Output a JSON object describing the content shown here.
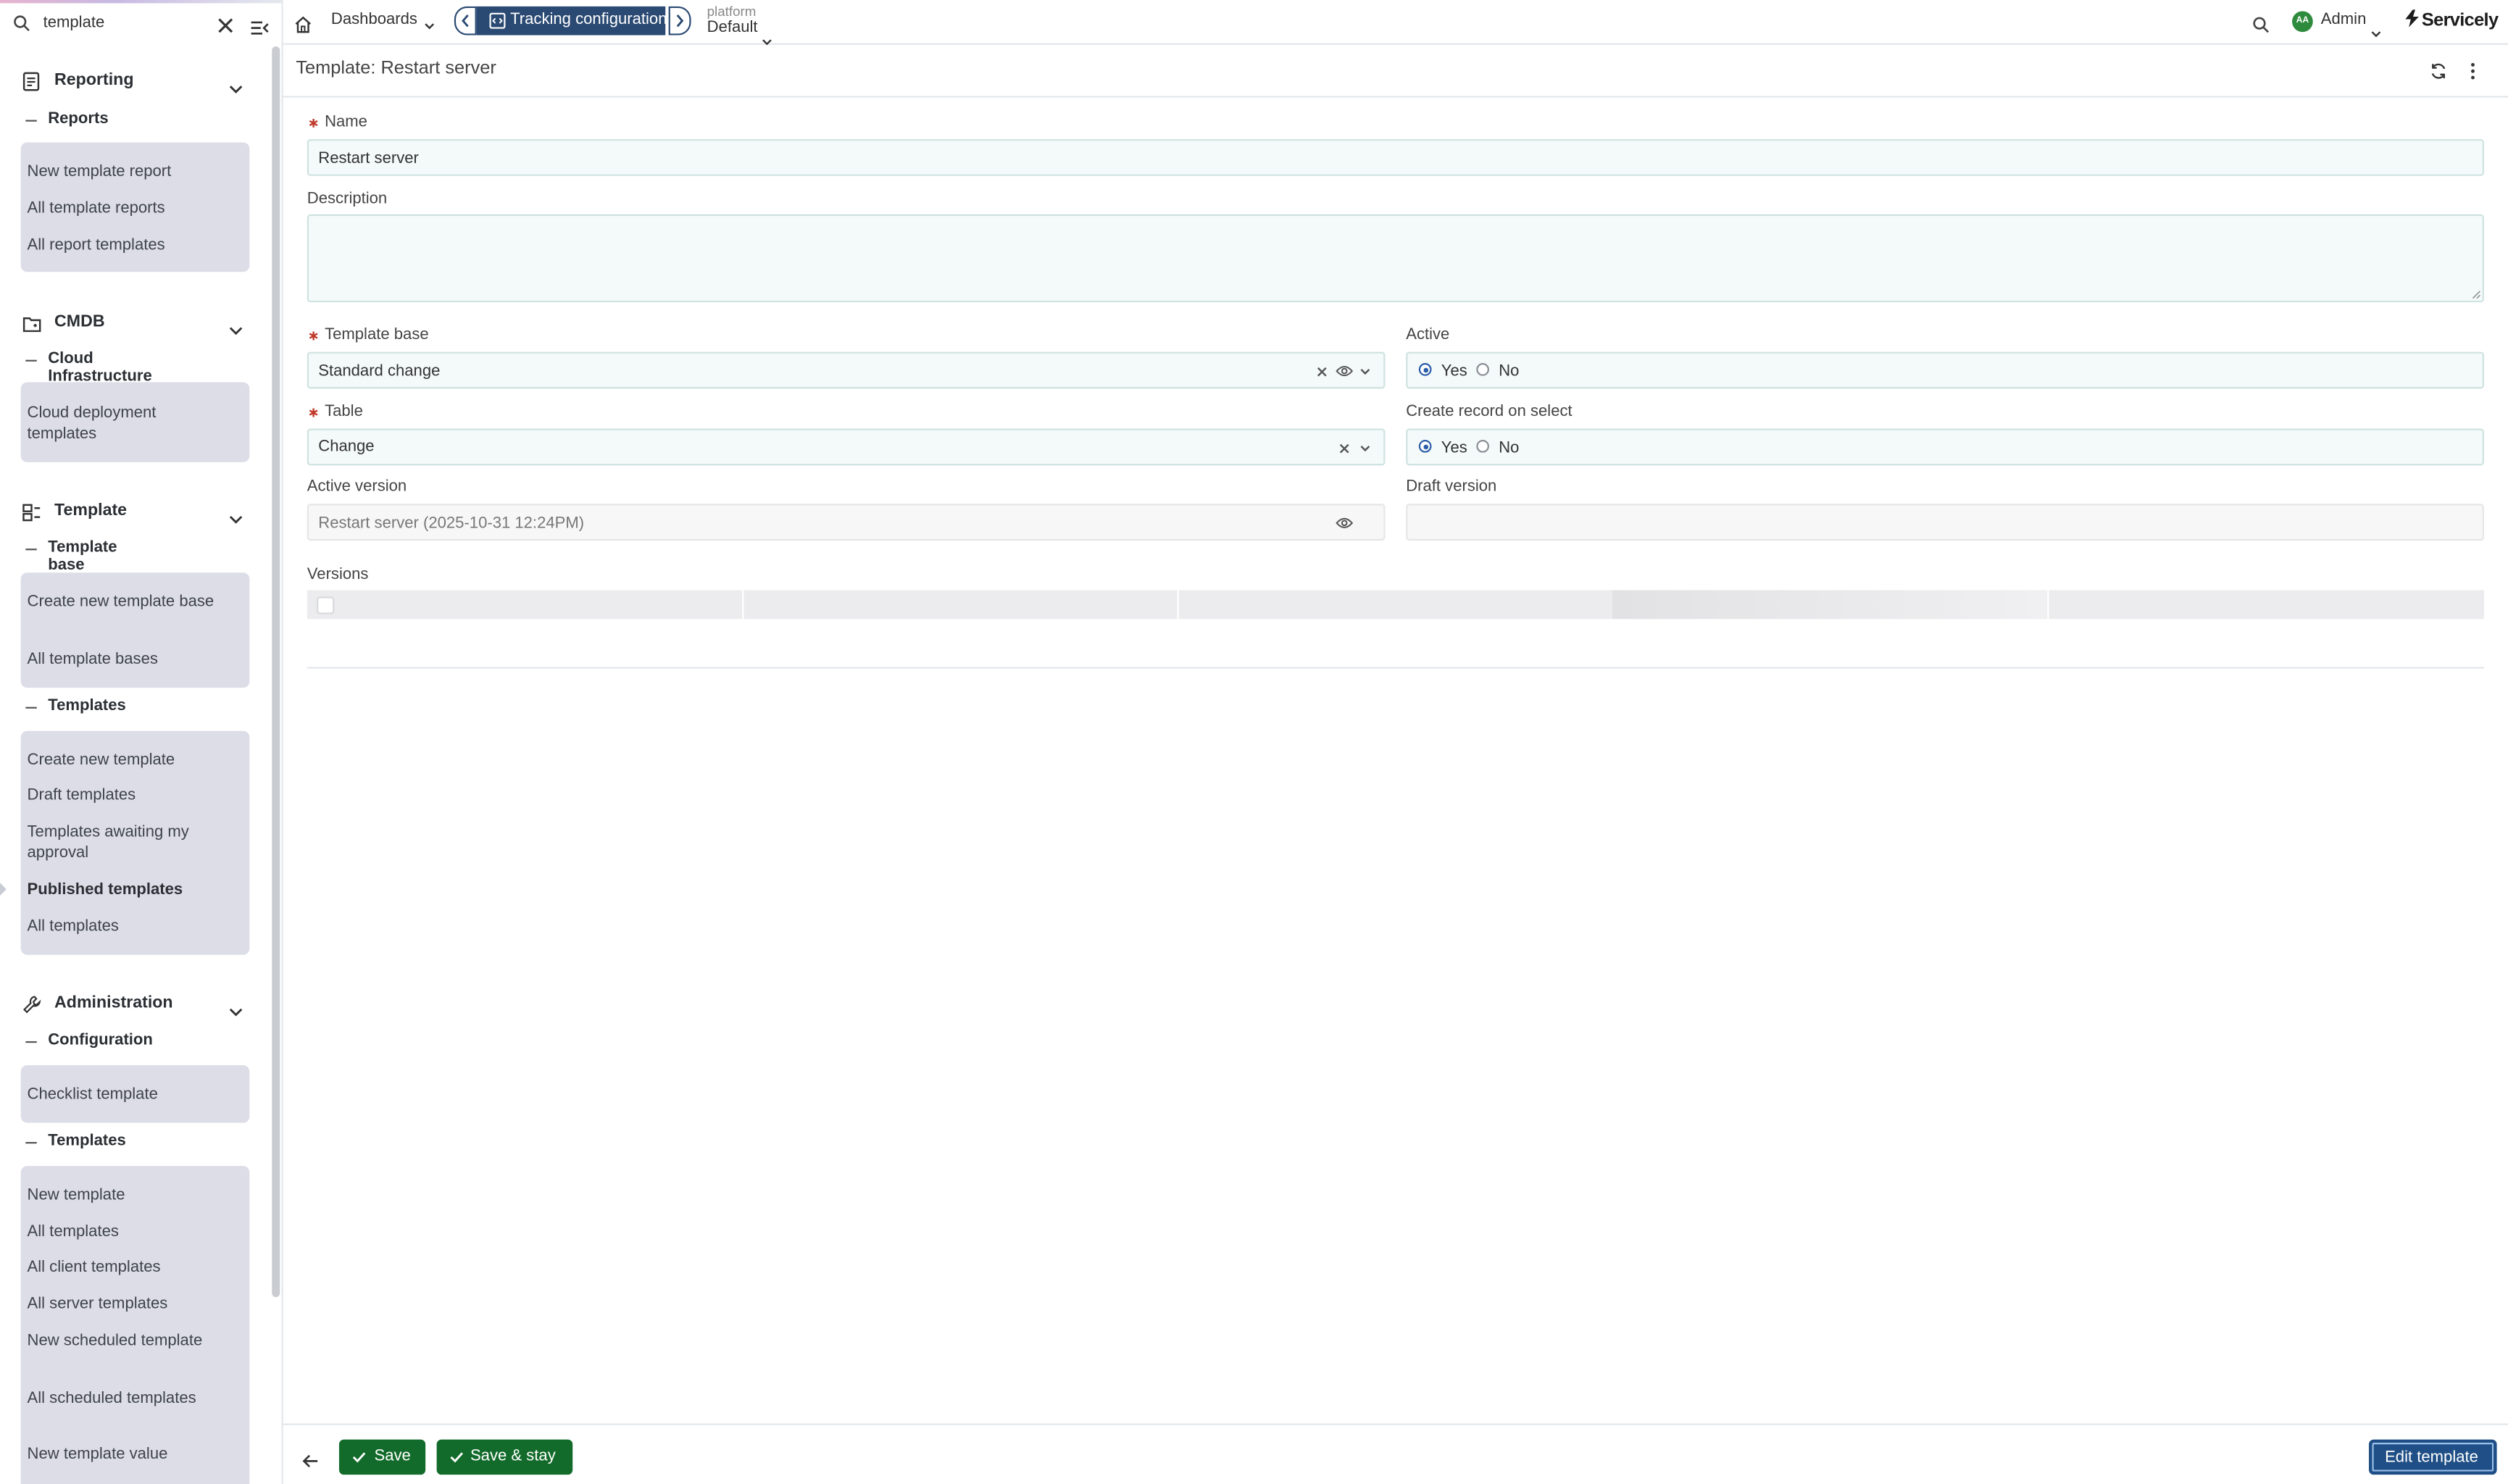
{
  "search": {
    "value": "template"
  },
  "sidebar": {
    "sections": [
      {
        "label": "Reporting",
        "icon": "report-icon",
        "groups": [
          {
            "label": "Reports",
            "items": [
              "New template report",
              "All template reports",
              "All report templates"
            ]
          }
        ]
      },
      {
        "label": "CMDB",
        "icon": "cmdb-icon",
        "groups": [
          {
            "label": "Cloud Infrastructure",
            "items": [
              "Cloud deployment templates"
            ]
          }
        ]
      },
      {
        "label": "Template",
        "icon": "template-icon",
        "groups": [
          {
            "label": "Template base",
            "items": [
              "Create new template base",
              "All template bases"
            ]
          },
          {
            "label": "Templates",
            "items": [
              "Create new template",
              "Draft templates",
              "Templates awaiting my approval",
              "Published templates",
              "All templates"
            ]
          }
        ]
      },
      {
        "label": "Administration",
        "icon": "wrench-icon",
        "groups": [
          {
            "label": "Configuration",
            "items": [
              "Checklist template"
            ]
          },
          {
            "label": "Templates",
            "items": [
              "New template",
              "All templates",
              "All client templates",
              "All server templates",
              "New scheduled template",
              "All scheduled templates",
              "New template value"
            ]
          }
        ]
      }
    ]
  },
  "topbar": {
    "dashboards": "Dashboards",
    "tab": "Tracking configuration",
    "platform_label": "platform",
    "platform_value": "Default",
    "user_initials": "AA",
    "user": "Admin",
    "brand": "Servicely"
  },
  "record": {
    "title": "Template: Restart server"
  },
  "form": {
    "name_label": "Name",
    "name_value": "Restart server",
    "description_label": "Description",
    "description_value": "",
    "template_base_label": "Template base",
    "template_base_value": "Standard change",
    "table_label": "Table",
    "table_value": "Change",
    "active_label": "Active",
    "create_record_label": "Create record on select",
    "yes": "Yes",
    "no": "No",
    "active_version_label": "Active version",
    "active_version_value": "Restart server (2025-10-31 12:24PM)",
    "draft_version_label": "Draft version",
    "draft_version_value": "",
    "versions_label": "Versions"
  },
  "footer": {
    "save": "Save",
    "save_stay": "Save & stay",
    "edit": "Edit template"
  },
  "colors": {
    "primary": "#2b4a73",
    "save": "#126b2a",
    "edit": "#1f4f86",
    "required": "#c0392b"
  }
}
